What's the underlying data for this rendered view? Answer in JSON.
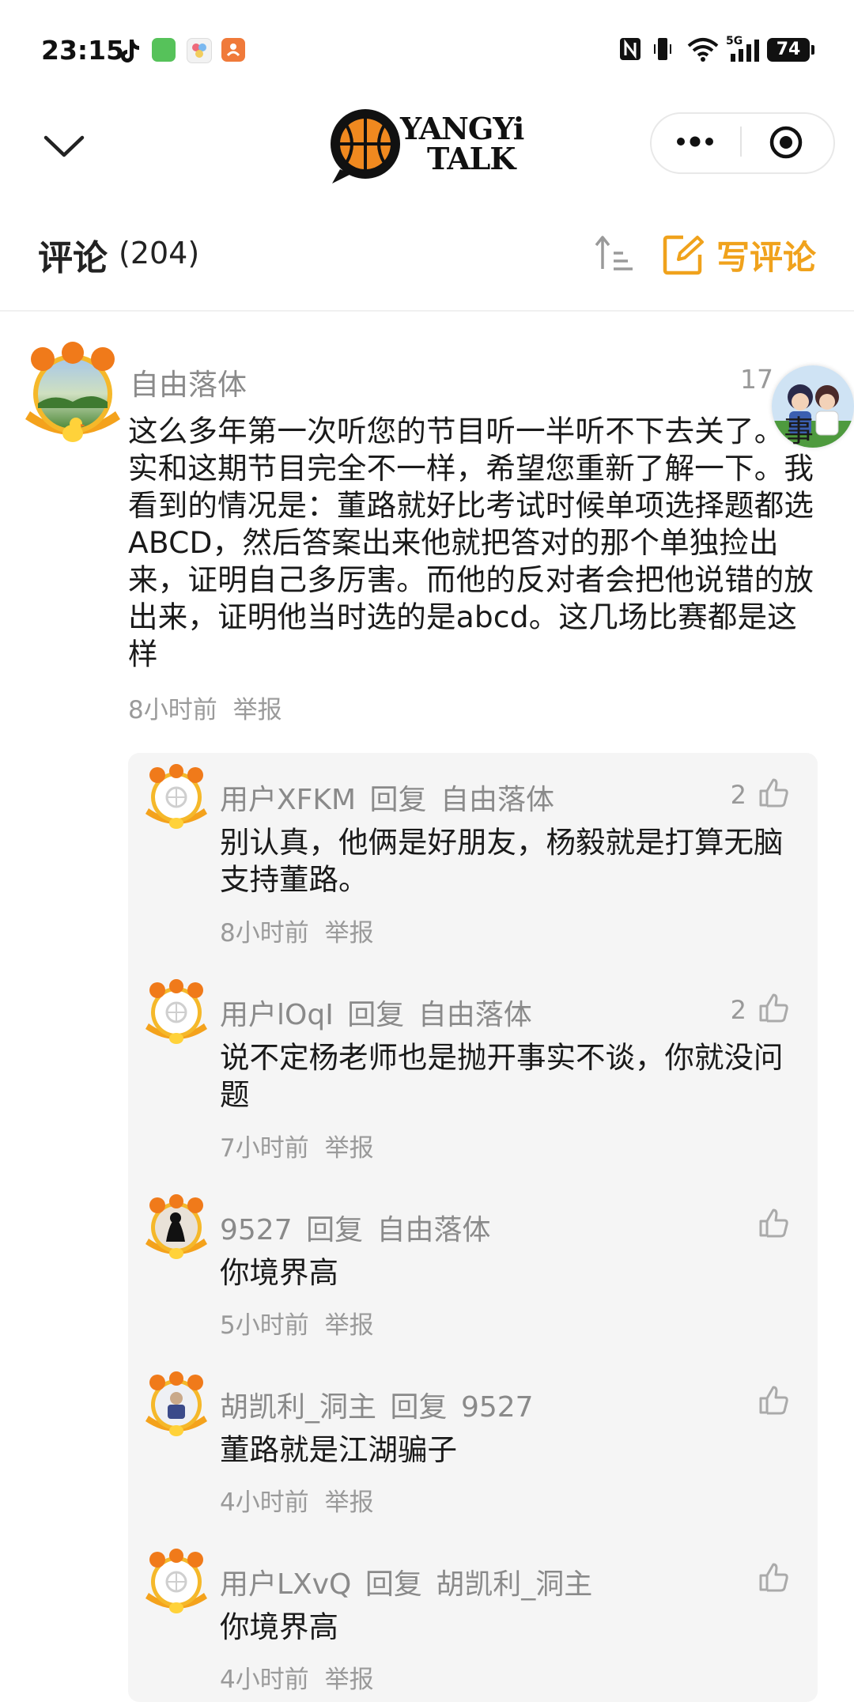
{
  "status_bar": {
    "time": "23:15",
    "battery": "74",
    "network": "5G"
  },
  "header": {
    "logo_text_line1": "YANGYi",
    "logo_text_line2": "TALK"
  },
  "comments_header": {
    "title": "评论",
    "count": "(204)",
    "write_label": "写评论"
  },
  "colors": {
    "accent": "#f0a21c",
    "muted": "#8a8a8a",
    "reply_bg": "#f5f5f5"
  },
  "main_comment": {
    "author": "自由落体",
    "likes": "17",
    "text": "这么多年第一次听您的节目听一半听不下去关了。事实和这期节目完全不一样，希望您重新了解一下。我看到的情况是：董路就好比考试时候单项选择题都选ABCD，然后答案出来他就把答对的那个单独捡出来，证明自己多厉害。而他的反对者会把他说错的放出来，证明他当时选的是abcd。这几场比赛都是这样",
    "time": "8小时前",
    "report": "举报"
  },
  "replies": [
    {
      "author": "用户XFKM",
      "reply_word": "回复",
      "target": "自由落体",
      "likes": "2",
      "text": "别认真，他俩是好朋友，杨毅就是打算无脑支持董路。",
      "time": "8小时前",
      "report": "举报"
    },
    {
      "author": "用户lOqI",
      "reply_word": "回复",
      "target": "自由落体",
      "likes": "2",
      "text": "说不定杨老师也是抛开事实不谈，你就没问题",
      "time": "7小时前",
      "report": "举报"
    },
    {
      "author": "9527",
      "reply_word": "回复",
      "target": "自由落体",
      "likes": "",
      "text": "你境界高",
      "time": "5小时前",
      "report": "举报"
    },
    {
      "author": "胡凯利_洞主",
      "reply_word": "回复",
      "target": "9527",
      "likes": "",
      "text": "董路就是江湖骗子",
      "time": "4小时前",
      "report": "举报"
    },
    {
      "author": "用户LXvQ",
      "reply_word": "回复",
      "target": "胡凯利_洞主",
      "likes": "",
      "text": "你境界高",
      "time": "4小时前",
      "report": "举报"
    }
  ]
}
